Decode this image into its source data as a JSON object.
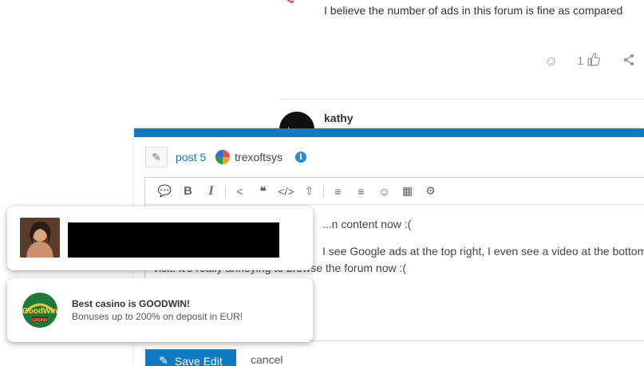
{
  "post": {
    "text": "I believe the number of ads in this forum is fine as compared",
    "vote_count": "1"
  },
  "next_post": {
    "author": "kathy"
  },
  "composer": {
    "post_link": "post 5",
    "username": "trexoftsys",
    "body_line1": "...n content now :(",
    "body_line2": "I see Google ads at the top right, I even see a video at the bottom right that auto-plays on ev",
    "body_line3": "visit. It's really annoying to browse the forum now :(",
    "save_label": "Save Edit",
    "cancel_label": "cancel"
  },
  "notifications": [
    {
      "title": "",
      "subtitle": ""
    },
    {
      "title": "Best casino is GOODWIN!",
      "subtitle": "Bonuses up to 200% on deposit in EUR!"
    }
  ],
  "colors": {
    "accent": "#0e7ac2",
    "info": "#2a8bd0"
  }
}
